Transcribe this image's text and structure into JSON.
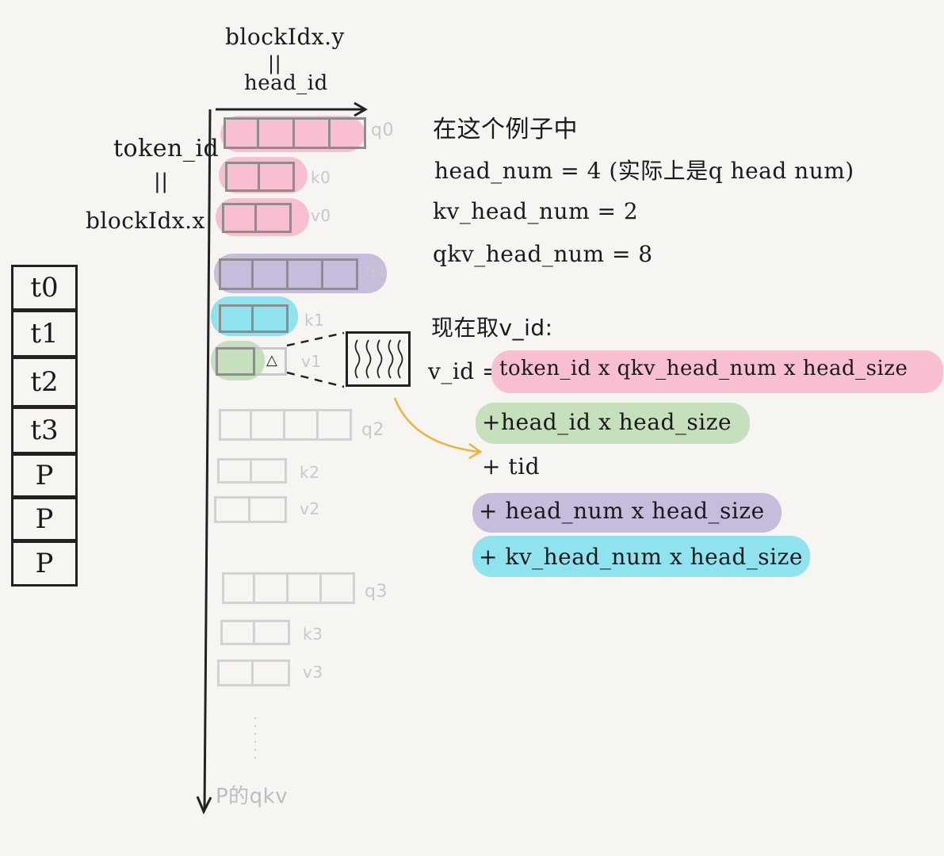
{
  "axis": {
    "top_label_1": "blockIdx.y",
    "top_equals": "||",
    "top_label_2": "head_id",
    "left_label_1": "token_id",
    "left_equals": "||",
    "left_label_2": "blockIdx.x",
    "bottom_label": "P的qkv"
  },
  "tokens": [
    "t0",
    "t1",
    "t2",
    "t3",
    "P",
    "P",
    "P"
  ],
  "blocks": {
    "q0": "q0",
    "k0": "k0",
    "v0": "v0",
    "q1": "q1",
    "k1": "k1",
    "v1": "v1",
    "q2": "q2",
    "k2": "k2",
    "v2": "v2",
    "q3": "q3",
    "k3": "k3",
    "v3": "v3",
    "marker": "△"
  },
  "notes": {
    "line1": "在这个例子中",
    "line2": "head_num = 4 (实际上是q head num)",
    "line3": "kv_head_num = 2",
    "line4": "qkv_head_num = 8",
    "line5": "现在取v_id:"
  },
  "formula": {
    "lhs": "v_id =",
    "term1": "token_id x qkv_head_num x head_size",
    "term2": "+head_id x head_size",
    "term3": "+ tid",
    "term4": "+ head_num x head_size",
    "term5": "+ kv_head_num x head_size"
  },
  "colors": {
    "pink": "#f7bfcf",
    "purple": "#c7bcdc",
    "cyan": "#8fe3ef",
    "green": "#c6dfbc",
    "arrow": "#f0b23a"
  }
}
